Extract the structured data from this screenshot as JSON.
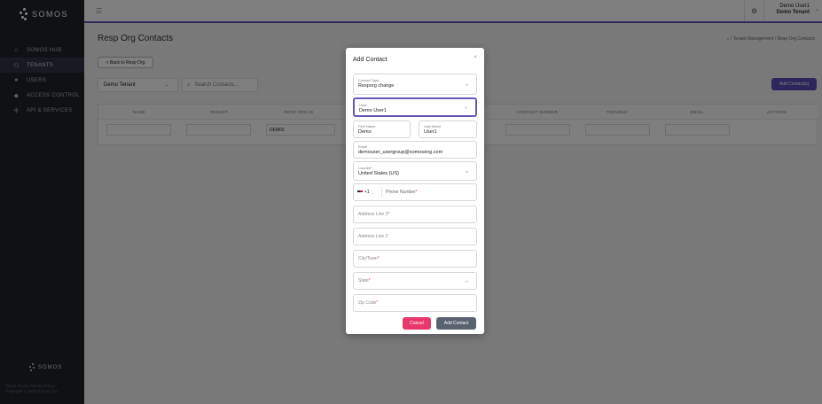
{
  "sidebar": {
    "brand": "SOMOS",
    "items": [
      {
        "icon": "home-icon",
        "label": "SOMOS HUB"
      },
      {
        "icon": "users-icon",
        "label": "TENANTS"
      },
      {
        "icon": "user-icon",
        "label": "USERS"
      },
      {
        "icon": "shield-icon",
        "label": "ACCESS CONTROL"
      },
      {
        "icon": "puzzle-icon",
        "label": "API & SERVICES"
      }
    ],
    "footer_brand": "SOMOS",
    "footer_links": "Terms of Use   Privacy Policy",
    "copyright": "Copyright © 2024 Somos, Inc."
  },
  "topbar": {
    "user_name": "Demo User1",
    "tenant_name": "Demo Tenant"
  },
  "page": {
    "title": "Resp Org Contacts",
    "breadcrumb": "/ Tenant Management / Resp Org Contacts",
    "back_label": "< Back to Resp Org",
    "tenant_value": "Demo Tenant",
    "search_placeholder": "Search Contacts...",
    "add_contacts_label": "Add Contact(s)"
  },
  "table": {
    "columns": [
      "NAME",
      "TENANT",
      "RESP ORG ID",
      "",
      "",
      "CONTACT NUMBER",
      "TROUBLE",
      "EMAIL",
      "ACTIONS"
    ],
    "row_resp_org": "DEM02"
  },
  "modal": {
    "title": "Add Contact",
    "contact_type_label": "Contact Type",
    "contact_type_value": "Resporg change",
    "user_label": "User",
    "user_value": "Demo User1",
    "first_name_label": "First Name",
    "first_name_value": "Demo",
    "last_name_label": "Last Name",
    "last_name_value": "User1",
    "email_label": "Email",
    "email_value": "demouser_usergroup@somoseng.com",
    "country_label": "Country",
    "country_value": "United States (US)",
    "phone_code": "+1",
    "phone_placeholder": "Phone Number",
    "address1_placeholder": "Address Line 1",
    "address2_placeholder": "Address Line 2",
    "city_placeholder": "City/Town",
    "state_placeholder": "State",
    "zip_placeholder": "Zip Code",
    "cancel_label": "Cancel",
    "submit_label": "Add Contact"
  },
  "colors": {
    "accent": "#5b4db8",
    "cancel": "#e8386b",
    "sidebar": "#1f2328"
  }
}
